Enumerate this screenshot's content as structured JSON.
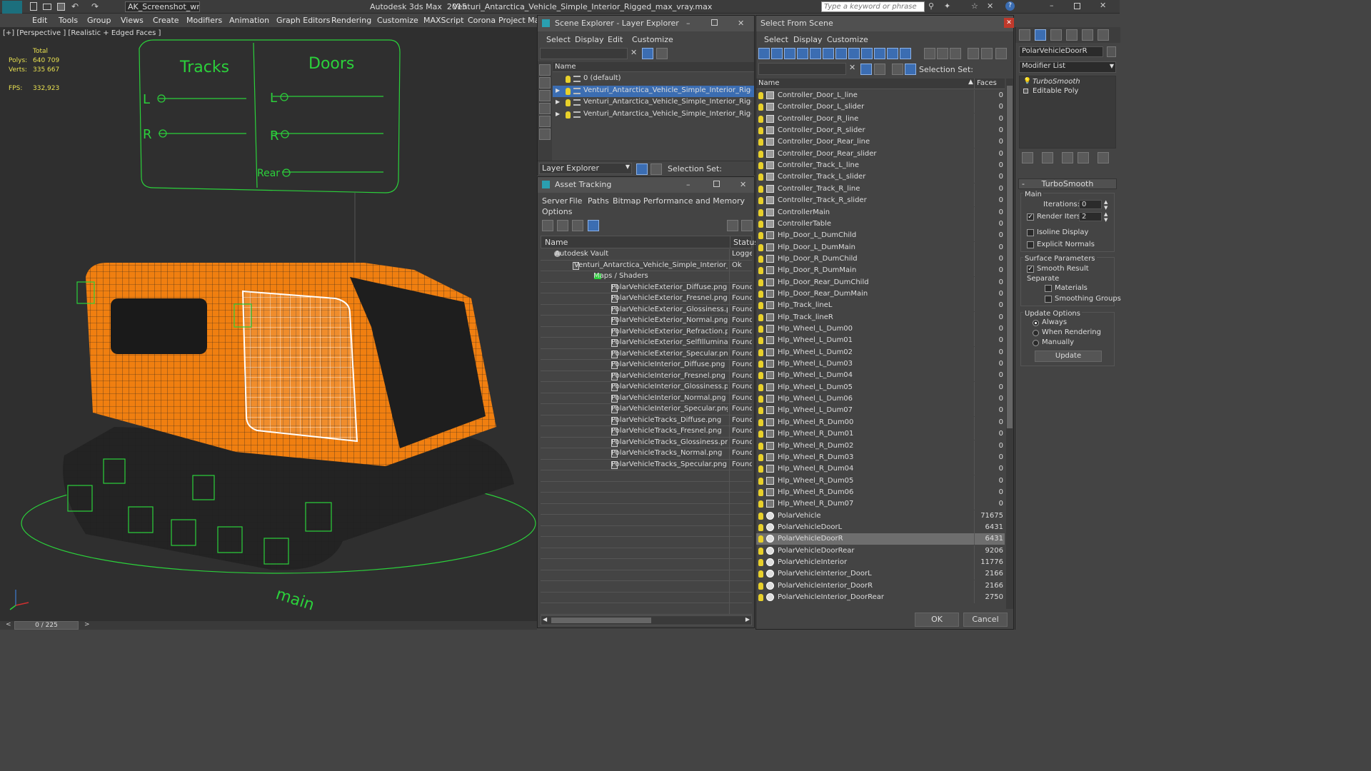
{
  "titlebar": {
    "workspace": "AK_Screenshot_wrksp",
    "app_title": "Autodesk 3ds Max  2015",
    "file_title": "Venturi_Antarctica_Vehicle_Simple_Interior_Rigged_max_vray.max",
    "search_placeholder": "Type a keyword or phrase",
    "logo": "MAX"
  },
  "menu": [
    "Edit",
    "Tools",
    "Group",
    "Views",
    "Create",
    "Modifiers",
    "Animation",
    "Graph Editors",
    "Rendering",
    "Customize",
    "MAXScript",
    "Corona",
    "Project Man"
  ],
  "viewport": {
    "label": "[+] [Perspective ] [Realistic + Edged Faces ]",
    "stats_total": "Total",
    "polys_label": "Polys:",
    "polys_value": "640 709",
    "verts_label": "Verts:",
    "verts_value": "335 667",
    "fps_label": "FPS:",
    "fps_value": "332,923",
    "tracks_label": "Tracks",
    "doors_label": "Doors",
    "l_label": "L",
    "r_label": "R",
    "rear_label": "Rear",
    "main_label": "main"
  },
  "timeline": {
    "frame": "0 / 225"
  },
  "scene_explorer": {
    "title": "Scene Explorer - Layer Explorer",
    "menu": [
      "Select",
      "Display",
      "Edit",
      "Customize"
    ],
    "col_name": "Name",
    "layers": [
      {
        "name": "0 (default)",
        "selected": false,
        "expand": false
      },
      {
        "name": "Venturi_Antarctica_Vehicle_Simple_Interior_Rigged",
        "selected": true,
        "expand": true
      },
      {
        "name": "Venturi_Antarctica_Vehicle_Simple_Interior_Rigged_contr…",
        "selected": false,
        "expand": true
      },
      {
        "name": "Venturi_Antarctica_Vehicle_Simple_Interior_Rigged_helpers",
        "selected": false,
        "expand": true
      }
    ],
    "footer_dropdown": "Layer Explorer",
    "selection_set": "Selection Set:"
  },
  "asset_tracking": {
    "title": "Asset Tracking",
    "menu": [
      "Server",
      "File",
      "Paths",
      "Bitmap Performance and Memory"
    ],
    "menu2": "Options",
    "col_name": "Name",
    "col_status": "Status",
    "rows": [
      {
        "name": "Autodesk Vault",
        "status": "Logged",
        "indent": 1
      },
      {
        "name": "Venturi_Antarctica_Vehicle_Simple_Interior_Rigg…",
        "status": "Ok",
        "indent": 2
      },
      {
        "name": "Maps / Shaders",
        "status": "",
        "indent": 3
      },
      {
        "name": "PolarVehicleExterior_Diffuse.png",
        "status": "Found",
        "indent": 4
      },
      {
        "name": "PolarVehicleExterior_Fresnel.png",
        "status": "Found",
        "indent": 4
      },
      {
        "name": "PolarVehicleExterior_Glossiness.png",
        "status": "Found",
        "indent": 4
      },
      {
        "name": "PolarVehicleExterior_Normal.png",
        "status": "Found",
        "indent": 4
      },
      {
        "name": "PolarVehicleExterior_Refraction.png",
        "status": "Found",
        "indent": 4
      },
      {
        "name": "PolarVehicleExterior_SelfIllumination.png",
        "status": "Found",
        "indent": 4
      },
      {
        "name": "PolarVehicleExterior_Specular.png",
        "status": "Found",
        "indent": 4
      },
      {
        "name": "PolarVehicleInterior_Diffuse.png",
        "status": "Found",
        "indent": 4
      },
      {
        "name": "PolarVehicleInterior_Fresnel.png",
        "status": "Found",
        "indent": 4
      },
      {
        "name": "PolarVehicleInterior_Glossiness.png",
        "status": "Found",
        "indent": 4
      },
      {
        "name": "PolarVehicleInterior_Normal.png",
        "status": "Found",
        "indent": 4
      },
      {
        "name": "PolarVehicleInterior_Specular.png",
        "status": "Found",
        "indent": 4
      },
      {
        "name": "PolarVehicleTracks_Diffuse.png",
        "status": "Found",
        "indent": 4
      },
      {
        "name": "PolarVehicleTracks_Fresnel.png",
        "status": "Found",
        "indent": 4
      },
      {
        "name": "PolarVehicleTracks_Glossiness.png",
        "status": "Found",
        "indent": 4
      },
      {
        "name": "PolarVehicleTracks_Normal.png",
        "status": "Found",
        "indent": 4
      },
      {
        "name": "PolarVehicleTracks_Specular.png",
        "status": "Found",
        "indent": 4
      }
    ]
  },
  "select_from_scene": {
    "title": "Select From Scene",
    "menu": [
      "Select",
      "Display",
      "Customize"
    ],
    "selection_set": "Selection Set:",
    "col_name": "Name",
    "col_faces": "Faces",
    "ok_label": "OK",
    "cancel_label": "Cancel",
    "objects": [
      {
        "name": "Controller_Door_L_line",
        "faces": "0",
        "icon": "shape"
      },
      {
        "name": "Controller_Door_L_slider",
        "faces": "0",
        "icon": "shape"
      },
      {
        "name": "Controller_Door_R_line",
        "faces": "0",
        "icon": "shape"
      },
      {
        "name": "Controller_Door_R_slider",
        "faces": "0",
        "icon": "shape"
      },
      {
        "name": "Controller_Door_Rear_line",
        "faces": "0",
        "icon": "shape"
      },
      {
        "name": "Controller_Door_Rear_slider",
        "faces": "0",
        "icon": "shape"
      },
      {
        "name": "Controller_Track_L_line",
        "faces": "0",
        "icon": "shape"
      },
      {
        "name": "Controller_Track_L_slider",
        "faces": "0",
        "icon": "shape"
      },
      {
        "name": "Controller_Track_R_line",
        "faces": "0",
        "icon": "shape"
      },
      {
        "name": "Controller_Track_R_slider",
        "faces": "0",
        "icon": "shape"
      },
      {
        "name": "ControllerMain",
        "faces": "0",
        "icon": "shape"
      },
      {
        "name": "ControllerTable",
        "faces": "0",
        "icon": "shape"
      },
      {
        "name": "Hlp_Door_L_DumChild",
        "faces": "0",
        "icon": "helper"
      },
      {
        "name": "Hlp_Door_L_DumMain",
        "faces": "0",
        "icon": "helper"
      },
      {
        "name": "Hlp_Door_R_DumChild",
        "faces": "0",
        "icon": "helper"
      },
      {
        "name": "Hlp_Door_R_DumMain",
        "faces": "0",
        "icon": "helper"
      },
      {
        "name": "Hlp_Door_Rear_DumChild",
        "faces": "0",
        "icon": "helper"
      },
      {
        "name": "Hlp_Door_Rear_DumMain",
        "faces": "0",
        "icon": "helper"
      },
      {
        "name": "Hlp_Track_lineL",
        "faces": "0",
        "icon": "helper"
      },
      {
        "name": "Hlp_Track_lineR",
        "faces": "0",
        "icon": "helper"
      },
      {
        "name": "Hlp_Wheel_L_Dum00",
        "faces": "0",
        "icon": "helper"
      },
      {
        "name": "Hlp_Wheel_L_Dum01",
        "faces": "0",
        "icon": "helper"
      },
      {
        "name": "Hlp_Wheel_L_Dum02",
        "faces": "0",
        "icon": "helper"
      },
      {
        "name": "Hlp_Wheel_L_Dum03",
        "faces": "0",
        "icon": "helper"
      },
      {
        "name": "Hlp_Wheel_L_Dum04",
        "faces": "0",
        "icon": "helper"
      },
      {
        "name": "Hlp_Wheel_L_Dum05",
        "faces": "0",
        "icon": "helper"
      },
      {
        "name": "Hlp_Wheel_L_Dum06",
        "faces": "0",
        "icon": "helper"
      },
      {
        "name": "Hlp_Wheel_L_Dum07",
        "faces": "0",
        "icon": "helper"
      },
      {
        "name": "Hlp_Wheel_R_Dum00",
        "faces": "0",
        "icon": "helper"
      },
      {
        "name": "Hlp_Wheel_R_Dum01",
        "faces": "0",
        "icon": "helper"
      },
      {
        "name": "Hlp_Wheel_R_Dum02",
        "faces": "0",
        "icon": "helper"
      },
      {
        "name": "Hlp_Wheel_R_Dum03",
        "faces": "0",
        "icon": "helper"
      },
      {
        "name": "Hlp_Wheel_R_Dum04",
        "faces": "0",
        "icon": "helper"
      },
      {
        "name": "Hlp_Wheel_R_Dum05",
        "faces": "0",
        "icon": "helper"
      },
      {
        "name": "Hlp_Wheel_R_Dum06",
        "faces": "0",
        "icon": "helper"
      },
      {
        "name": "Hlp_Wheel_R_Dum07",
        "faces": "0",
        "icon": "helper"
      },
      {
        "name": "PolarVehicle",
        "faces": "71675",
        "icon": "geo"
      },
      {
        "name": "PolarVehicleDoorL",
        "faces": "6431",
        "icon": "geo"
      },
      {
        "name": "PolarVehicleDoorR",
        "faces": "6431",
        "icon": "geo",
        "selected": true
      },
      {
        "name": "PolarVehicleDoorRear",
        "faces": "9206",
        "icon": "geo"
      },
      {
        "name": "PolarVehicleInterior",
        "faces": "11776",
        "icon": "geo"
      },
      {
        "name": "PolarVehicleInterior_DoorL",
        "faces": "2166",
        "icon": "geo"
      },
      {
        "name": "PolarVehicleInterior_DoorR",
        "faces": "2166",
        "icon": "geo"
      },
      {
        "name": "PolarVehicleInterior_DoorRear",
        "faces": "2750",
        "icon": "geo"
      }
    ]
  },
  "command_panel": {
    "object_name": "PolarVehicleDoorR",
    "modifier_list": "Modifier List",
    "stack": [
      "TurboSmooth",
      "Editable Poly"
    ],
    "rollout_title": "TurboSmooth",
    "main_group": "Main",
    "iterations_label": "Iterations:",
    "iterations_value": "0",
    "render_iters_label": "Render Iters:",
    "render_iters_value": "2",
    "isoline_label": "Isoline Display",
    "explicit_label": "Explicit Normals",
    "surface_group": "Surface Parameters",
    "smooth_result_label": "Smooth Result",
    "separate_label": "Separate",
    "materials_label": "Materials",
    "smoothing_label": "Smoothing Groups",
    "update_group": "Update Options",
    "always_label": "Always",
    "when_rendering_label": "When Rendering",
    "manually_label": "Manually",
    "update_button": "Update"
  },
  "colors": {
    "accent": "#3b6db2",
    "orange": "#f07f10",
    "green": "#2bd13b",
    "selection": "#6e6e6e"
  }
}
